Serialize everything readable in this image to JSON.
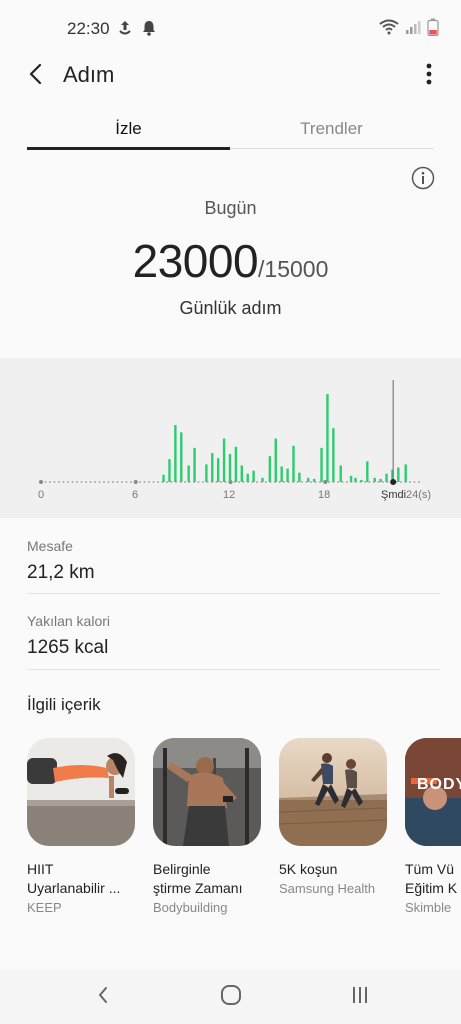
{
  "status": {
    "time": "22:30",
    "icons": [
      "upload-icon",
      "bell-icon",
      "wifi-icon",
      "signal-icon",
      "battery-icon"
    ]
  },
  "header": {
    "title": "Adım",
    "back_icon": "back-arrow-icon",
    "more_icon": "more-vertical-icon"
  },
  "tabs": [
    {
      "label": "İzle",
      "selected": true
    },
    {
      "label": "Trendler",
      "selected": false
    }
  ],
  "summary": {
    "period_label": "Bugün",
    "steps": "23000",
    "goal": "/15000",
    "caption": "Günlük adım"
  },
  "chart_data": {
    "type": "bar",
    "x_unit": "(s)",
    "x_ticks": [
      "0",
      "6",
      "12",
      "18",
      "Şmdi",
      "24(s)"
    ],
    "now_hour": 22.3,
    "accent_color": "#2ecc71",
    "bars": [
      {
        "x": 8.3,
        "v": 7
      },
      {
        "x": 8.7,
        "v": 22
      },
      {
        "x": 9.1,
        "v": 55
      },
      {
        "x": 9.5,
        "v": 48
      },
      {
        "x": 10.0,
        "v": 16
      },
      {
        "x": 10.4,
        "v": 33
      },
      {
        "x": 11.2,
        "v": 17
      },
      {
        "x": 11.6,
        "v": 28
      },
      {
        "x": 12.0,
        "v": 23
      },
      {
        "x": 12.4,
        "v": 42
      },
      {
        "x": 12.8,
        "v": 27
      },
      {
        "x": 13.2,
        "v": 34
      },
      {
        "x": 13.6,
        "v": 16
      },
      {
        "x": 14.0,
        "v": 8
      },
      {
        "x": 14.4,
        "v": 11
      },
      {
        "x": 15.0,
        "v": 4
      },
      {
        "x": 15.5,
        "v": 25
      },
      {
        "x": 15.9,
        "v": 42
      },
      {
        "x": 16.3,
        "v": 15
      },
      {
        "x": 16.7,
        "v": 13
      },
      {
        "x": 17.1,
        "v": 35
      },
      {
        "x": 17.5,
        "v": 9
      },
      {
        "x": 18.1,
        "v": 4
      },
      {
        "x": 18.5,
        "v": 3
      },
      {
        "x": 19.0,
        "v": 33
      },
      {
        "x": 19.4,
        "v": 85
      },
      {
        "x": 19.8,
        "v": 52
      },
      {
        "x": 20.3,
        "v": 16
      },
      {
        "x": 21.0,
        "v": 6
      },
      {
        "x": 21.3,
        "v": 4
      },
      {
        "x": 21.7,
        "v": 2
      },
      {
        "x": 22.1,
        "v": 20
      },
      {
        "x": 22.6,
        "v": 4
      },
      {
        "x": 23.0,
        "v": 3
      },
      {
        "x": 23.4,
        "v": 8
      },
      {
        "x": 23.8,
        "v": 12
      },
      {
        "x": 24.2,
        "v": 14
      },
      {
        "x": 24.7,
        "v": 17
      }
    ]
  },
  "stats": {
    "distance_label": "Mesafe",
    "distance_value": "21,2 km",
    "calories_label": "Yakılan kalori",
    "calories_value": "1265 kcal"
  },
  "related": {
    "title": "İlgili içerik",
    "cards": [
      {
        "title": "HIIT\nUyarlanabilir ...",
        "source": "KEEP"
      },
      {
        "title": "Belirginle\nştirme Zamanı",
        "source": "Bodybuilding"
      },
      {
        "title": "5K koşun",
        "source": "Samsung Health"
      },
      {
        "title": "Tüm Vü\nEğitim K",
        "source": "Skimble",
        "thumb_text": "BODY"
      }
    ]
  },
  "nav": {
    "back_icon": "nav-back-icon",
    "home_icon": "nav-home-icon",
    "recents_icon": "nav-recents-icon"
  }
}
